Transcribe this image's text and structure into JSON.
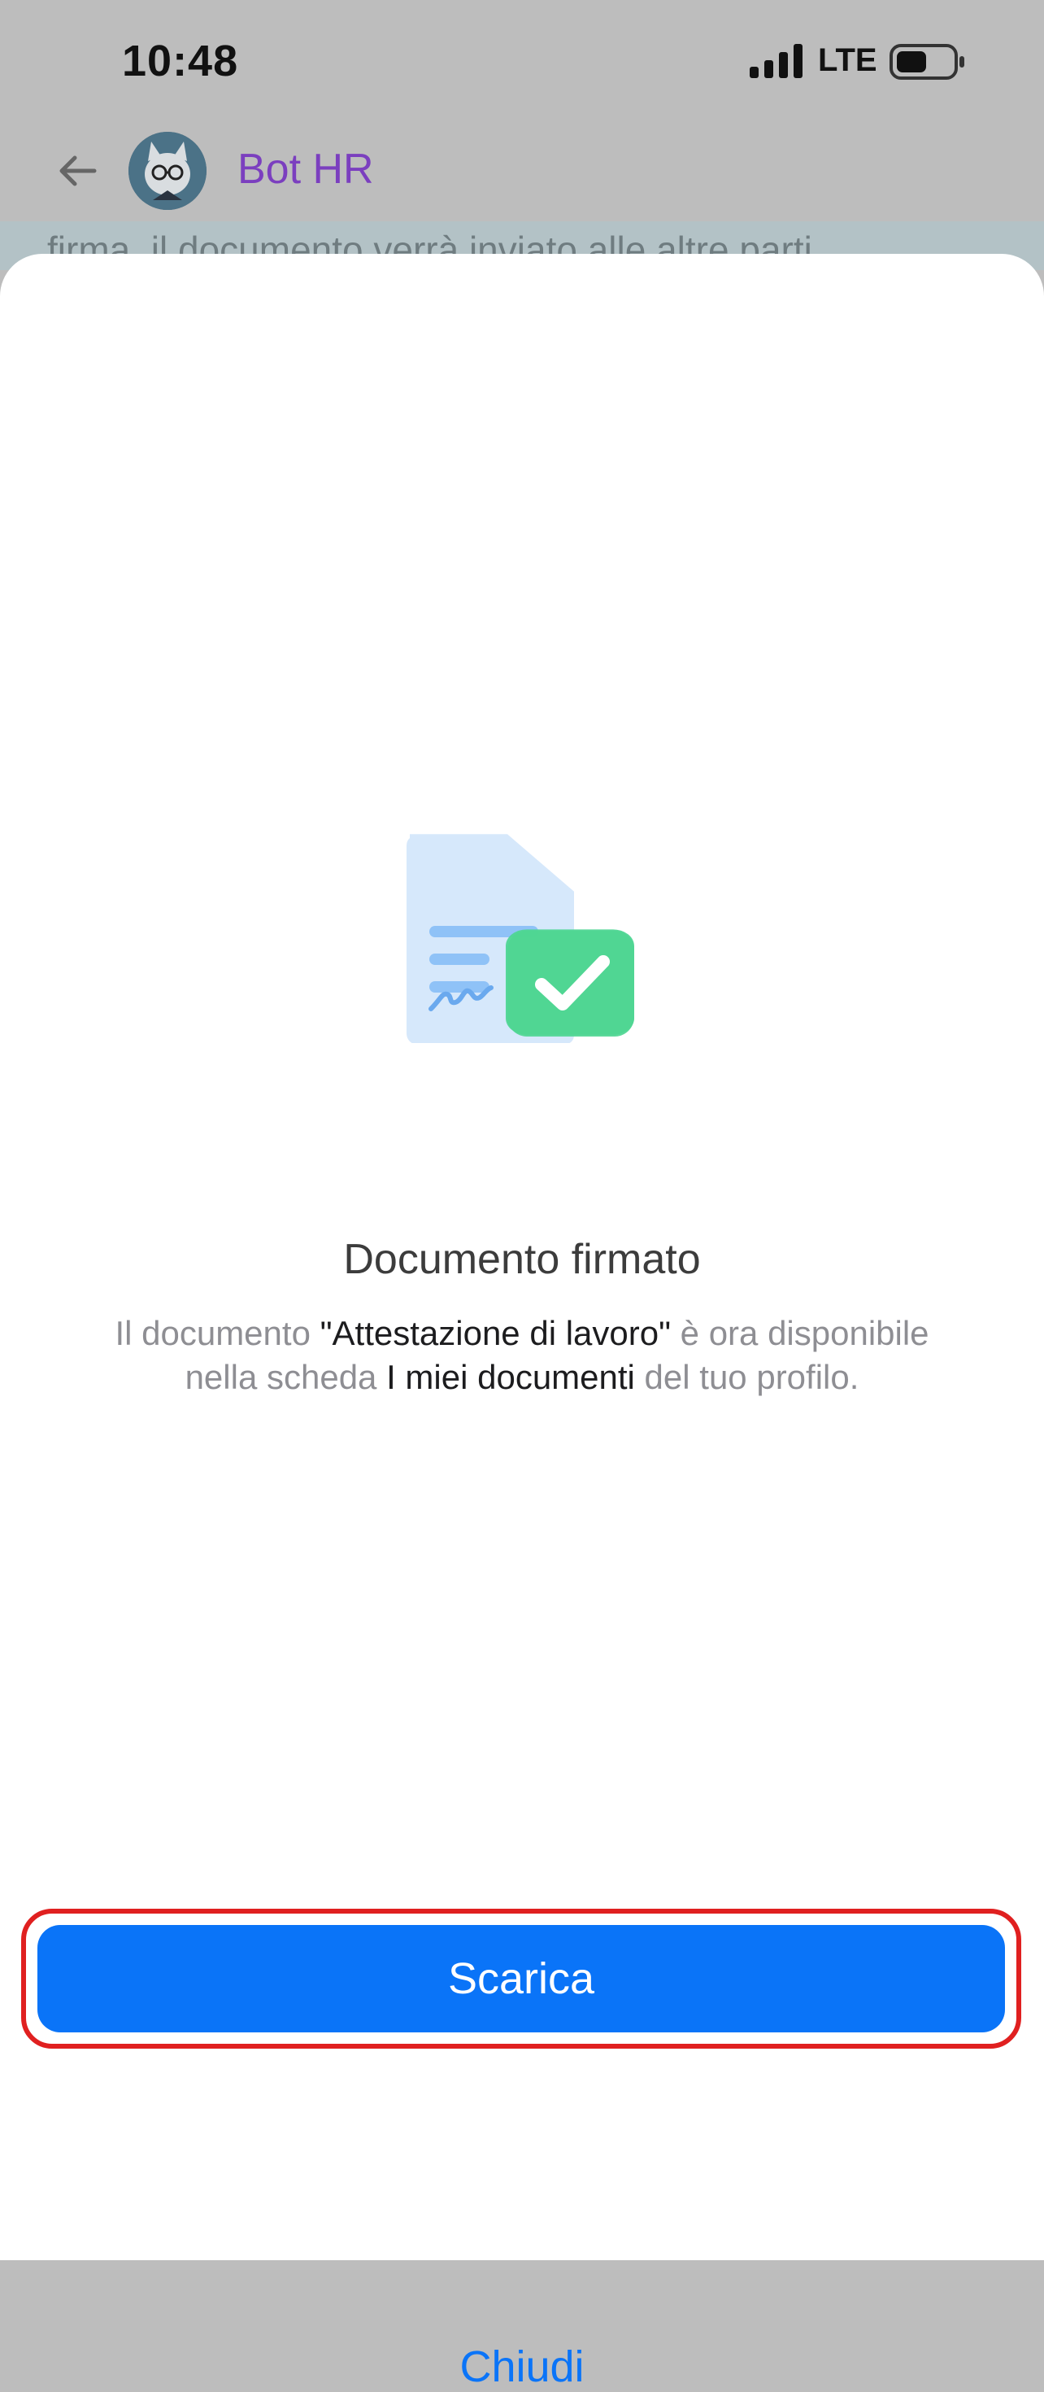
{
  "status_bar": {
    "time": "10:48",
    "network": "LTE"
  },
  "chat": {
    "title": "Bot HR",
    "snippet": "firma, il documento verrà inviato alle altre parti",
    "title_color": "#7b3fbf"
  },
  "sheet": {
    "title": "Documento firmato",
    "message": {
      "part1": "Il documento ",
      "doc_name": "\"Attestazione di lavoro\"",
      "part2": " è ora disponibile nella scheda ",
      "tab_name": "I miei documenti",
      "part3": " del tuo profilo."
    },
    "download_label": "Scarica",
    "close_label": "Chiudi",
    "accent_color": "#0a74f8",
    "success_color": "#4fd693"
  },
  "icons": [
    "back-arrow-icon",
    "signal-icon",
    "battery-icon",
    "document-signed-icon",
    "checkmark-icon"
  ]
}
